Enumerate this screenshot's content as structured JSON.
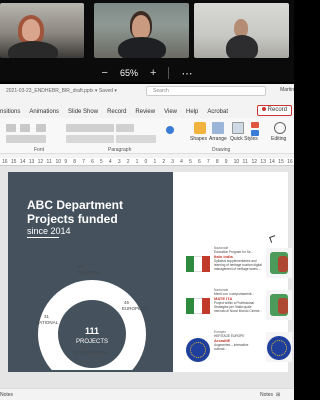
{
  "video_call": {
    "zoom_minus": "−",
    "zoom_level": "65%",
    "zoom_plus": "+"
  },
  "ppt": {
    "file_name": "2021-03-23_ENDHEBR_BIR_draft.pptx ▾ Saved ▾",
    "search_placeholder": "Search",
    "user_name": "Martin",
    "tabs": [
      "nsitions",
      "Animations",
      "Slide Show",
      "Record",
      "Review",
      "View",
      "Help",
      "Acrobat"
    ],
    "record_label": "Record",
    "ribbon": {
      "font_group": "Font",
      "paragraph_group": "Paragraph",
      "drawing_group": "Drawing",
      "shapes": "Shapes",
      "arrange": "Arrange",
      "quick_styles": "Quick Styles",
      "editing": "Editing"
    },
    "ruler_ticks": [
      "16",
      "15",
      "14",
      "13",
      "12",
      "11",
      "10",
      "9",
      "8",
      "7",
      "6",
      "5",
      "4",
      "3",
      "2",
      "1",
      "0",
      "1",
      "2",
      "3",
      "4",
      "5",
      "6",
      "7",
      "8",
      "9",
      "10",
      "11",
      "12",
      "13",
      "14",
      "15",
      "16"
    ],
    "status": {
      "notes": "Notes",
      "notes_button": "Notes",
      "comments_button": "⊞"
    }
  },
  "slide": {
    "title": "ABC Department Projects funded",
    "subtitle": "since 2014",
    "center_value": "111",
    "center_label": "PROJECTS",
    "segments": [
      {
        "value": "33",
        "label": "REGIONAL"
      },
      {
        "value": "45",
        "label": "EUROPEAN"
      },
      {
        "value": "2",
        "label": "INTERNATIONAL"
      },
      {
        "value": "31",
        "label": "NATIONAL"
      }
    ],
    "cards": [
      {
        "kicker": "Nazionale",
        "head_pre": "Education Program for Se...",
        "title": "Italo india",
        "body": "Syllabus supplementaries and learning of heritage tourism digital management of heritage towns ..."
      },
      {
        "kicker": "Nazionale",
        "head_pre": "Menti con i comportamenti...",
        "title": "MATE ITA",
        "body": "Project within a Professional Strategies per l'Italia quale mercato di Nuovi Mondo Cinese..."
      },
      {
        "kicker": "Europeo",
        "head_pre": "HERITAGE EUROPE",
        "title": "ArcadiiE",
        "body": "Augmented – interactive cultural..."
      }
    ]
  }
}
